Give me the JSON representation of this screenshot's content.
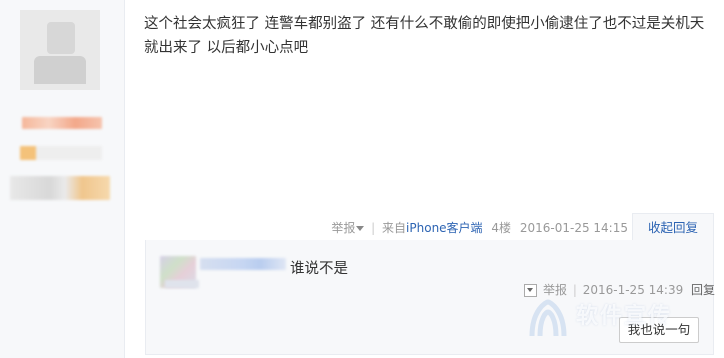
{
  "post": {
    "text": "这个社会太疯狂了 连警车都别盗了 还有什么不敢偷的即使把小偷逮住了也不过是关机天就出来了 以后都小心点吧",
    "report_label": "举报",
    "source_prefix": "来自",
    "source_link": "iPhone客户端",
    "floor": "4楼",
    "timestamp": "2016-01-25 14:15",
    "collapse_label": "收起回复"
  },
  "reply": {
    "text": "谁说不是",
    "report_label": "举报",
    "timestamp": "2016-1-25 14:39",
    "reply_label": "回复",
    "button_label": "我也说一句"
  },
  "watermark": {
    "text": "软件宣传"
  },
  "colors": {
    "link": "#2d64b3",
    "meta": "#999999",
    "panel": "#f7f8fa"
  }
}
